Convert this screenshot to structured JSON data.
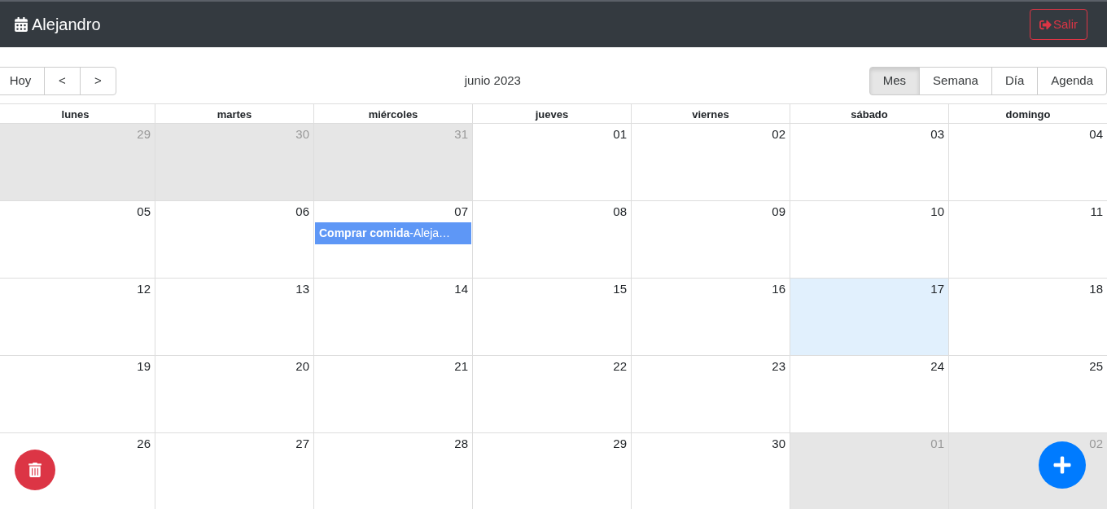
{
  "navbar": {
    "title": "Alejandro",
    "logout_label": "Salir"
  },
  "toolbar": {
    "nav_buttons": [
      "Hoy",
      "<",
      ">"
    ],
    "label": "junio 2023",
    "views": [
      {
        "label": "Mes",
        "selected": true
      },
      {
        "label": "Semana",
        "selected": false
      },
      {
        "label": "Día",
        "selected": false
      },
      {
        "label": "Agenda",
        "selected": false
      }
    ]
  },
  "calendar": {
    "weekdays": [
      "lunes",
      "martes",
      "miércoles",
      "jueves",
      "viernes",
      "sábado",
      "domingo"
    ],
    "weeks": [
      {
        "days": [
          {
            "day": "29",
            "off_range": true,
            "today": false
          },
          {
            "day": "30",
            "off_range": true,
            "today": false
          },
          {
            "day": "31",
            "off_range": true,
            "today": false
          },
          {
            "day": "01",
            "off_range": false,
            "today": false
          },
          {
            "day": "02",
            "off_range": false,
            "today": false
          },
          {
            "day": "03",
            "off_range": false,
            "today": false
          },
          {
            "day": "04",
            "off_range": false,
            "today": false
          }
        ]
      },
      {
        "days": [
          {
            "day": "05",
            "off_range": false,
            "today": false
          },
          {
            "day": "06",
            "off_range": false,
            "today": false
          },
          {
            "day": "07",
            "off_range": false,
            "today": false,
            "events": [
              "**Comprar comida**-Aleja…"
            ]
          },
          {
            "day": "08",
            "off_range": false,
            "today": false
          },
          {
            "day": "09",
            "off_range": false,
            "today": false
          },
          {
            "day": "10",
            "off_range": false,
            "today": false
          },
          {
            "day": "11",
            "off_range": false,
            "today": false
          }
        ]
      },
      {
        "days": [
          {
            "day": "12",
            "off_range": false,
            "today": false
          },
          {
            "day": "13",
            "off_range": false,
            "today": false
          },
          {
            "day": "14",
            "off_range": false,
            "today": false
          },
          {
            "day": "15",
            "off_range": false,
            "today": false
          },
          {
            "day": "16",
            "off_range": false,
            "today": false
          },
          {
            "day": "17",
            "off_range": false,
            "today": true
          },
          {
            "day": "18",
            "off_range": false,
            "today": false
          }
        ]
      },
      {
        "days": [
          {
            "day": "19",
            "off_range": false,
            "today": false
          },
          {
            "day": "20",
            "off_range": false,
            "today": false
          },
          {
            "day": "21",
            "off_range": false,
            "today": false
          },
          {
            "day": "22",
            "off_range": false,
            "today": false
          },
          {
            "day": "23",
            "off_range": false,
            "today": false
          },
          {
            "day": "24",
            "off_range": false,
            "today": false
          },
          {
            "day": "25",
            "off_range": false,
            "today": false
          }
        ]
      },
      {
        "days": [
          {
            "day": "26",
            "off_range": false,
            "today": false
          },
          {
            "day": "27",
            "off_range": false,
            "today": false
          },
          {
            "day": "28",
            "off_range": false,
            "today": false
          },
          {
            "day": "29",
            "off_range": false,
            "today": false
          },
          {
            "day": "30",
            "off_range": false,
            "today": false
          },
          {
            "day": "01",
            "off_range": true,
            "today": false
          },
          {
            "day": "02",
            "off_range": true,
            "today": false
          }
        ]
      }
    ]
  }
}
